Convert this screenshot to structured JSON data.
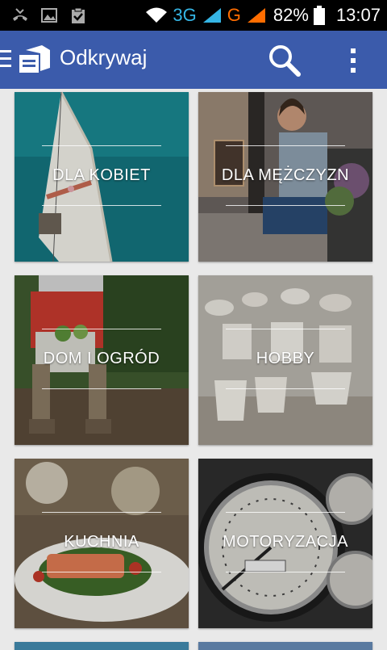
{
  "status_bar": {
    "network_3g": "3G",
    "network_g": "G",
    "battery_percent": "82%",
    "time": "13:07",
    "icons": [
      "missed-call-icon",
      "image-icon",
      "clipboard-check-icon",
      "wifi-icon",
      "signal-icon",
      "battery-icon"
    ]
  },
  "app_bar": {
    "title": "Odkrywaj",
    "icons": [
      "menu-icon",
      "app-logo-icon",
      "search-icon",
      "overflow-menu-icon"
    ],
    "color": "#3b5bab"
  },
  "categories": [
    {
      "label": "DLA KOBIET",
      "icon": "boat-deck-photo"
    },
    {
      "label": "DLA MĘŻCZYZN",
      "icon": "man-on-bench-photo"
    },
    {
      "label": "DOM I OGRÓD",
      "icon": "garden-basket-photo"
    },
    {
      "label": "HOBBY",
      "icon": "ceramic-cups-photo"
    },
    {
      "label": "KUCHNIA",
      "icon": "salmon-plate-photo"
    },
    {
      "label": "MOTORYZACJA",
      "icon": "dashboard-gauge-photo"
    }
  ]
}
